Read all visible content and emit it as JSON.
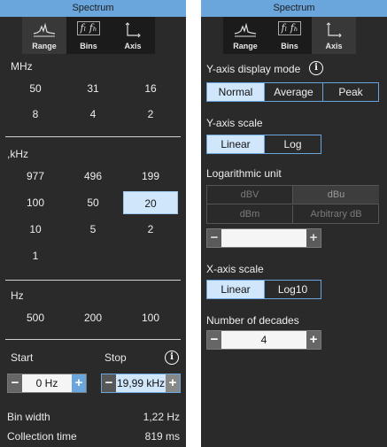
{
  "left": {
    "title": "Spectrum",
    "tabs": [
      {
        "label": "Range",
        "icon": "spectrum-icon"
      },
      {
        "label": "Bins",
        "icon": "bins-icon"
      },
      {
        "label": "Axis",
        "icon": "axis-icon"
      }
    ],
    "bins_glyph": "fₗ fₕ",
    "mhz": {
      "label": "MHz",
      "values": [
        "50",
        "31",
        "16",
        "8",
        "4",
        "2"
      ]
    },
    "khz": {
      "label": ",kHz",
      "values": [
        "977",
        "496",
        "199",
        "100",
        "50",
        "20",
        "10",
        "5",
        "2",
        "1"
      ],
      "selected": "20"
    },
    "hz": {
      "label": "Hz",
      "values": [
        "500",
        "200",
        "100"
      ]
    },
    "start": {
      "label": "Start",
      "value": "0 Hz"
    },
    "stop": {
      "label": "Stop",
      "value": "19,99 kHz"
    },
    "bin_width": {
      "label": "Bin width",
      "value": "1,22 Hz"
    },
    "collection_time": {
      "label": "Collection time",
      "value": "819 ms"
    }
  },
  "right": {
    "title": "Spectrum",
    "tabs": [
      {
        "label": "Range",
        "icon": "spectrum-icon"
      },
      {
        "label": "Bins",
        "icon": "bins-icon"
      },
      {
        "label": "Axis",
        "icon": "axis-icon"
      }
    ],
    "y_display_mode": {
      "label": "Y-axis display mode",
      "options": [
        "Normal",
        "Average",
        "Peak"
      ],
      "selected": "Normal"
    },
    "y_scale": {
      "label": "Y-axis scale",
      "options": [
        "Linear",
        "Log"
      ],
      "selected": "Linear"
    },
    "log_unit": {
      "label": "Logarithmic unit",
      "options": [
        "dBV",
        "dBu",
        "dBm",
        "Arbitrary dB"
      ],
      "selected": "dBu",
      "value": ""
    },
    "x_scale": {
      "label": "X-axis scale",
      "options": [
        "Linear",
        "Log10"
      ],
      "selected": "Linear"
    },
    "decades": {
      "label": "Number of decades",
      "value": "4"
    }
  },
  "colors": {
    "accent": "#6aa6dc",
    "panel": "#2a2a2a",
    "selected": "#cfe6fb"
  }
}
